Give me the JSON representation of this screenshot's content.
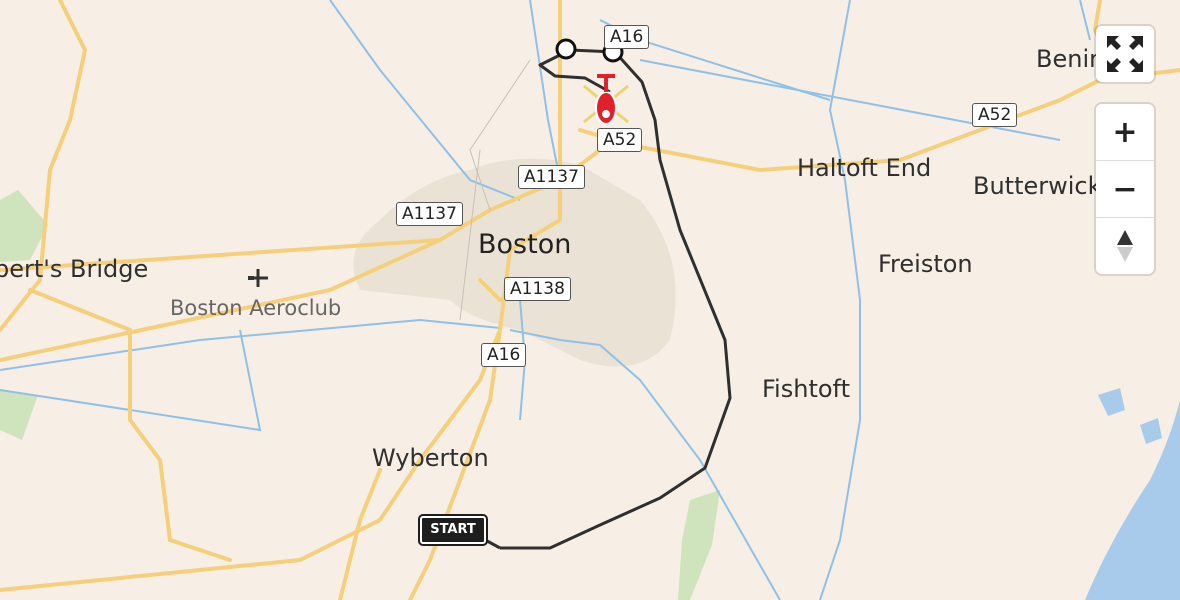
{
  "map": {
    "places": {
      "boston": "Boston",
      "wyberton": "Wyberton",
      "fishtoft": "Fishtoft",
      "freiston": "Freiston",
      "haltoft_end": "Haltoft End",
      "butterwick": "Butterwick",
      "benington": "Benin",
      "bridge": "bert's Bridge",
      "aeroclub": "Boston Aeroclub"
    },
    "roads": {
      "a16_top": "A16",
      "a52_main": "A52",
      "a52_east": "A52",
      "a1137_upper": "A1137",
      "a1137_lower": "A1137",
      "a1138": "A1138",
      "a16_south": "A16"
    },
    "route": {
      "start_label": "START"
    }
  },
  "controls": {
    "fullscreen_icon": "fullscreen-icon",
    "zoom_in_icon": "plus-icon",
    "zoom_out_icon": "minus-icon",
    "compass_icon": "compass-icon",
    "zoom_in": "+",
    "zoom_out": "−"
  },
  "colors": {
    "background": "#f7efe6",
    "major_road": "#f5cf7a",
    "water": "#8fc0e8",
    "sea": "#a9cbeb",
    "green": "#cfe3bd",
    "urban": "#ebe2d6",
    "route": "#2f2f2f",
    "helicopter": "#e0202a"
  }
}
